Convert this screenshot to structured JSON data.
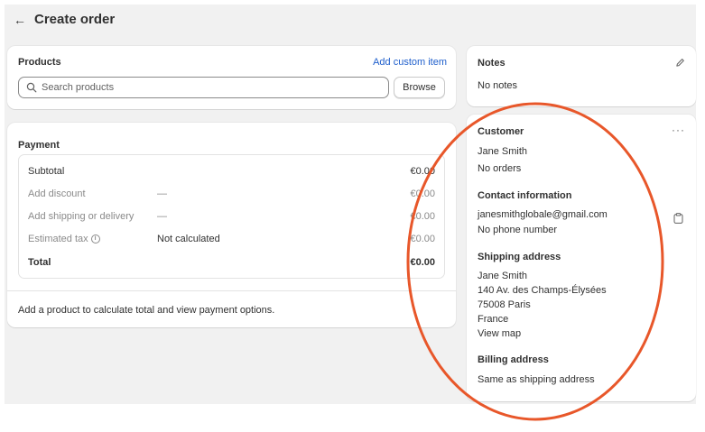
{
  "header": {
    "back_icon": "arrow-left-icon",
    "title": "Create order"
  },
  "products": {
    "title": "Products",
    "add_custom_item": "Add custom item",
    "search_placeholder": "Search products",
    "browse_label": "Browse"
  },
  "payment": {
    "title": "Payment",
    "rows": [
      {
        "label": "Subtotal",
        "middle": "",
        "amount": "€0.00"
      },
      {
        "label": "Add discount",
        "middle": "—",
        "amount": "€0.00"
      },
      {
        "label": "Add shipping or delivery",
        "middle": "—",
        "amount": "€0.00"
      },
      {
        "label": "Estimated tax",
        "middle": "Not calculated",
        "amount": "€0.00"
      },
      {
        "label": "Total",
        "middle": "",
        "amount": "€0.00"
      }
    ],
    "footer": "Add a product to calculate total and view payment options."
  },
  "notes": {
    "title": "Notes",
    "value": "No notes"
  },
  "customer": {
    "title": "Customer",
    "name": "Jane Smith",
    "orders": "No orders",
    "contact_title": "Contact information",
    "email": "janesmithglobale@gmail.com",
    "phone": "No phone number",
    "shipping_title": "Shipping address",
    "shipping_lines": [
      "Jane Smith",
      "140 Av. des Champs-Élysées",
      "75008 Paris",
      "France"
    ],
    "view_map": "View map",
    "billing_title": "Billing address",
    "billing_value": "Same as shipping address"
  },
  "colors": {
    "link": "#1f5fcc",
    "annotation": "#e8572a",
    "canvas": "#f1f1f1"
  }
}
